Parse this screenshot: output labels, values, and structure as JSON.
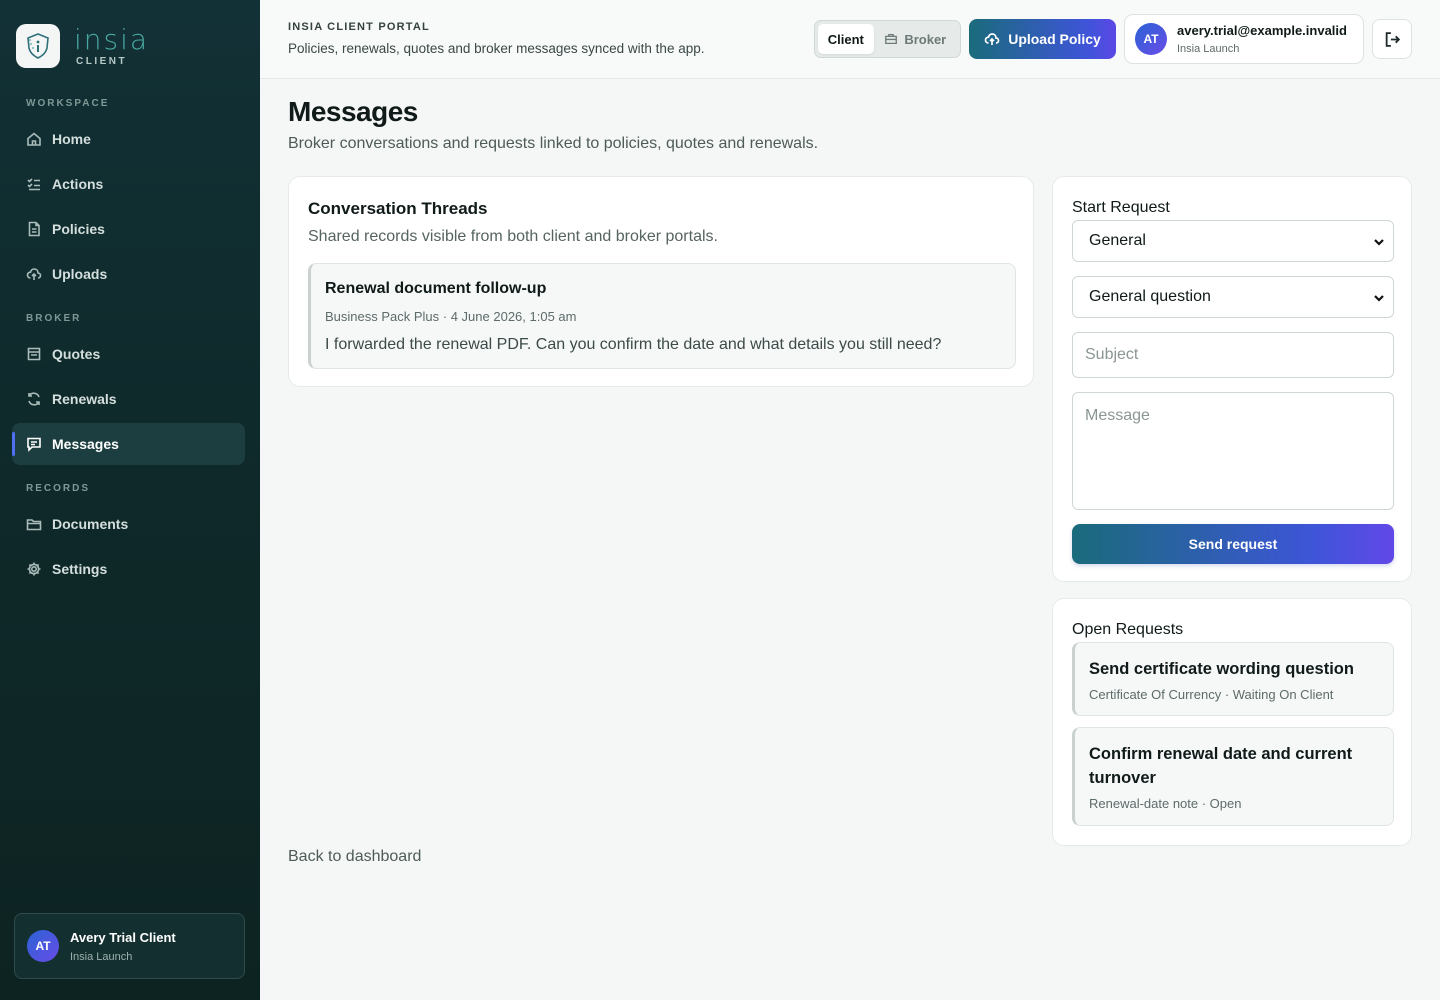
{
  "brand": {
    "name": "insia",
    "sub": "CLIENT"
  },
  "sidebar": {
    "sections": [
      {
        "label": "WORKSPACE"
      },
      {
        "label": "BROKER"
      },
      {
        "label": "RECORDS"
      }
    ],
    "items": [
      {
        "label": "Home",
        "icon": "home-icon"
      },
      {
        "label": "Actions",
        "icon": "checklist-icon"
      },
      {
        "label": "Policies",
        "icon": "document-icon"
      },
      {
        "label": "Uploads",
        "icon": "cloud-upload-icon"
      },
      {
        "label": "Quotes",
        "icon": "receipt-icon"
      },
      {
        "label": "Renewals",
        "icon": "refresh-icon"
      },
      {
        "label": "Messages",
        "icon": "chat-icon",
        "active": true
      },
      {
        "label": "Documents",
        "icon": "folder-icon"
      },
      {
        "label": "Settings",
        "icon": "gear-icon"
      }
    ],
    "user": {
      "initials": "AT",
      "name": "Avery Trial Client",
      "org": "Insia Launch"
    }
  },
  "header": {
    "portal_label": "INSIA CLIENT PORTAL",
    "portal_desc": "Policies, renewals, quotes and broker messages synced with the app.",
    "toggle": {
      "client": "Client",
      "broker": "Broker",
      "selected": "Client"
    },
    "upload_label": "Upload Policy",
    "account": {
      "initials": "AT",
      "email": "avery.trial@example.invalid",
      "org": "Insia Launch"
    }
  },
  "main": {
    "title": "Messages",
    "subtitle": "Broker conversations and requests linked to policies, quotes and renewals.",
    "threads": {
      "title": "Conversation Threads",
      "subtitle": "Shared records visible from both client and broker portals.",
      "items": [
        {
          "title": "Renewal document follow-up",
          "meta": "Business Pack Plus · 4 June 2026, 1:05 am",
          "body": "I forwarded the renewal PDF. Can you confirm the date and what details you still need?"
        }
      ]
    },
    "back_link": "Back to dashboard"
  },
  "request_form": {
    "title": "Start Request",
    "type_value": "General",
    "topic_value": "General question",
    "subject_placeholder": "Subject",
    "message_placeholder": "Message",
    "send_label": "Send request"
  },
  "open_requests": {
    "title": "Open Requests",
    "items": [
      {
        "title": "Send certificate wording question",
        "meta": "Certificate Of Currency · Waiting On Client"
      },
      {
        "title": "Confirm renewal date and current turnover",
        "meta": "Renewal-date note · Open"
      }
    ]
  },
  "colors": {
    "accent": "#4f6ef0",
    "sidebar_bg": "#0f2a2b",
    "brand_teal": "#4aa9a2"
  }
}
